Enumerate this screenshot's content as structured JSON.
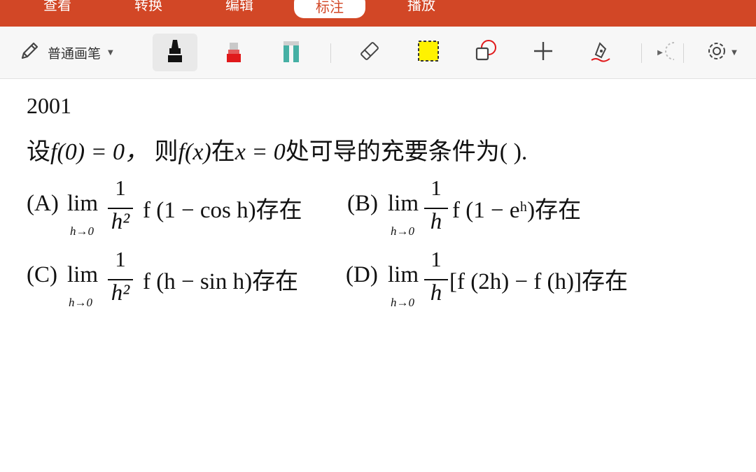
{
  "ribbon": {
    "tabs": [
      {
        "label": "查看",
        "active": false
      },
      {
        "label": "转换",
        "active": false
      },
      {
        "label": "编辑",
        "active": false
      },
      {
        "label": "标注",
        "active": true
      },
      {
        "label": "播放",
        "active": false
      }
    ],
    "accent_color": "#d24726"
  },
  "toolbar": {
    "pen_style_label": "普通画笔",
    "tools": [
      "pencil-icon",
      "black-marker-icon",
      "red-marker-icon",
      "teal-highlighter-icon",
      "eraser-icon",
      "yellow-box-icon",
      "shape-icon",
      "plus-icon",
      "signature-icon",
      "settings-icon"
    ],
    "colors": {
      "black_marker": "#111111",
      "red_marker": "#e0191b",
      "teal_marker": "#46b0a4",
      "yellow_box": "#fff200"
    }
  },
  "document": {
    "year": "2001",
    "question": {
      "prefix": "设",
      "f0": "f(0) = 0，",
      "mid": "则",
      "fx": "f(x)",
      "at": "在",
      "cond": "x = 0",
      "suffix": "处可导的充要条件为(    )."
    },
    "options": [
      {
        "label": "(A)",
        "lim": "lim",
        "sub": "h→0",
        "num": "1",
        "den": "h²",
        "expr": "f (1 − cos h)存在"
      },
      {
        "label": "(B)",
        "lim": "lim",
        "sub": "h→0",
        "num": "1",
        "den": "h",
        "expr": "f (1 − eʰ)存在"
      },
      {
        "label": "(C)",
        "lim": "lim",
        "sub": "h→0",
        "num": "1",
        "den": "h²",
        "expr": "f (h − sin h)存在"
      },
      {
        "label": "(D)",
        "lim": "lim",
        "sub": "h→0",
        "num": "1",
        "den": "h",
        "expr": "[f (2h) − f (h)]存在"
      }
    ]
  }
}
